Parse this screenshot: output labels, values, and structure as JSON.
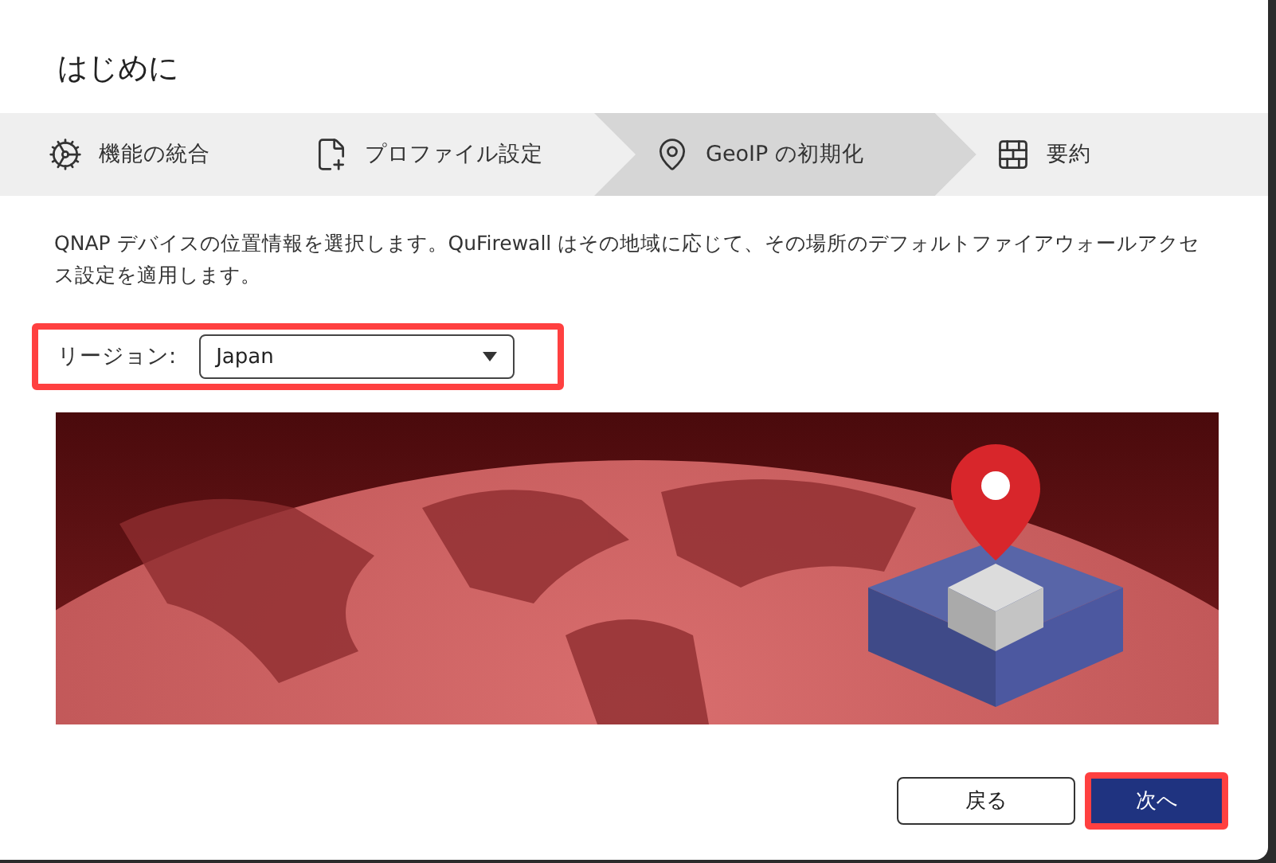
{
  "dialog": {
    "title": "はじめに"
  },
  "steps": [
    {
      "label": "機能の統合",
      "selected": false
    },
    {
      "label": "プロファイル設定",
      "selected": false
    },
    {
      "label": "GeoIP の初期化",
      "selected": true
    },
    {
      "label": "要約",
      "selected": false
    }
  ],
  "description": "QNAP デバイスの位置情報を選択します。QuFirewall はその地域に応じて、その場所のデフォルトファイアウォールアクセス設定を適用します。",
  "region": {
    "label": "リージョン:",
    "value": "Japan",
    "highlighted": true
  },
  "buttons": [
    {
      "label": "戻る",
      "kind": "secondary",
      "highlighted": false
    },
    {
      "label": "次へ",
      "kind": "primary",
      "highlighted": true
    }
  ]
}
